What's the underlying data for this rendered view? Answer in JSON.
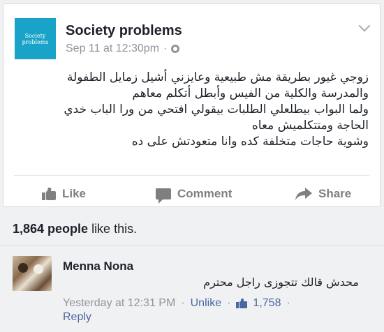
{
  "post": {
    "avatar_line1": "Society",
    "avatar_line2": "problems",
    "page_name": "Society problems",
    "timestamp": "Sep 11 at 12:30pm",
    "separator": "·",
    "body_lines": [
      "زوجي غيور بطريقة مش طبيعية وعايزني أشيل زمايل الطفولة",
      "والمدرسة والكلية من الفيس وأبطل أتكلم معاهم",
      "ولما البواب بيطلعلي الطلبات بيقولي افتحي من ورا الباب خدي",
      "الحاجة ومتتكلميش معاه",
      "وشوية حاجات متخلفة كده وانا متعودتش على ده"
    ]
  },
  "actions": {
    "like": "Like",
    "comment": "Comment",
    "share": "Share"
  },
  "likes": {
    "count": "1,864 people",
    "suffix": " like this."
  },
  "comment": {
    "author": "Menna Nona",
    "text": "محدش قالك تتجوزى راجل محترم",
    "time": "Yesterday at 12:31 PM",
    "dot": "·",
    "unlike": "Unlike",
    "like_count": "1,758",
    "reply": "Reply"
  },
  "colors": {
    "brand_blue": "#4b67a1",
    "avatar_teal": "#1aa3c8",
    "muted_gray": "#90949c"
  },
  "icons": [
    "globe-icon",
    "chevron-down-icon",
    "like-thumb-icon",
    "comment-bubble-icon",
    "share-arrow-icon"
  ]
}
